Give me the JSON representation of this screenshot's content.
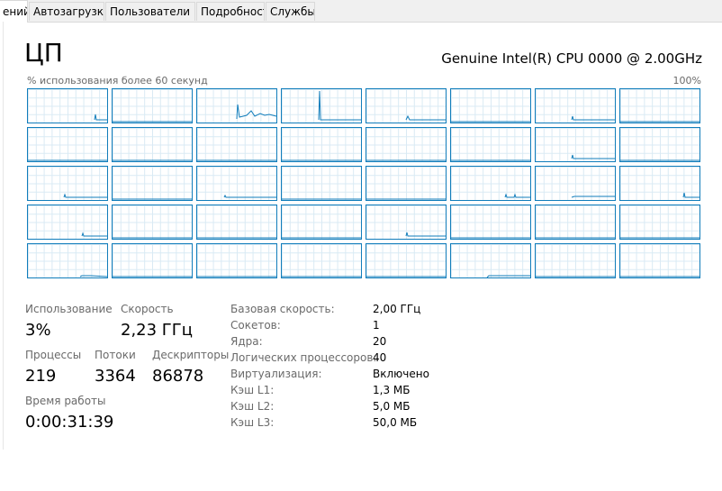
{
  "tabs": [
    {
      "label": "ений",
      "active": true
    },
    {
      "label": "Автозагрузка",
      "active": false
    },
    {
      "label": "Пользователи",
      "active": false
    },
    {
      "label": "Подробности",
      "active": false
    },
    {
      "label": "Службы",
      "active": false
    }
  ],
  "header": {
    "title": "ЦП",
    "cpu_name": "Genuine Intel(R) CPU 0000 @ 2.00GHz"
  },
  "graph": {
    "label": "% использования более 60 секунд",
    "max_label": "100%",
    "rows": 5,
    "cols": 8,
    "accent_color": "#117dbb",
    "grid_color": "#d9eaf4"
  },
  "stats": {
    "utilization_label": "Использование",
    "utilization_value": "3%",
    "speed_label": "Скорость",
    "speed_value": "2,23 ГГц",
    "processes_label": "Процессы",
    "processes_value": "219",
    "threads_label": "Потоки",
    "threads_value": "3364",
    "handles_label": "Дескрипторы",
    "handles_value": "86878",
    "uptime_label": "Время работы",
    "uptime_value": "0:00:31:39"
  },
  "specs": [
    {
      "label": "Базовая скорость:",
      "value": "2,00 ГГц"
    },
    {
      "label": "Сокетов:",
      "value": "1"
    },
    {
      "label": "Ядра:",
      "value": "20"
    },
    {
      "label": "Логических процессоров:",
      "value": "40"
    },
    {
      "label": "Виртуализация:",
      "value": "Включено"
    },
    {
      "label": "Кэш L1:",
      "value": "1,3 МБ"
    },
    {
      "label": "Кэш L2:",
      "value": "5,0 МБ"
    },
    {
      "label": "Кэш L3:",
      "value": "50,0 МБ"
    }
  ]
}
